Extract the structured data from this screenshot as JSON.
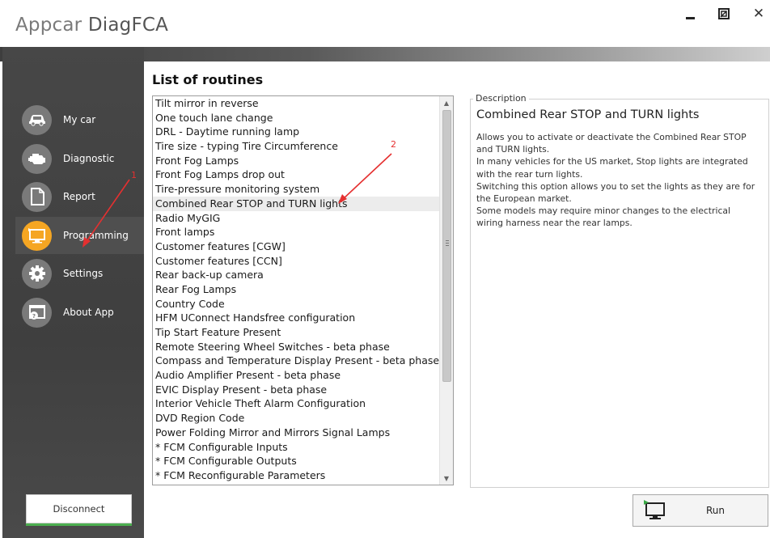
{
  "app": {
    "title_light": "Appcar ",
    "title_bold": "DiagFCA",
    "window_controls": {
      "minimize_icon": "minimize-icon",
      "maximize_icon": "maximize-icon",
      "close_glyph": "✕"
    }
  },
  "sidebar": {
    "items": [
      {
        "label": "My car",
        "icon": "car-icon",
        "active": false
      },
      {
        "label": "Diagnostic",
        "icon": "engine-icon",
        "active": false
      },
      {
        "label": "Report",
        "icon": "document-icon",
        "active": false
      },
      {
        "label": "Programming",
        "icon": "monitor-icon",
        "active": true
      },
      {
        "label": "Settings",
        "icon": "gear-icon",
        "active": false
      },
      {
        "label": "About App",
        "icon": "help-window-icon",
        "active": false
      }
    ],
    "disconnect_label": "Disconnect"
  },
  "main": {
    "title": "List of routines",
    "routines": [
      "Tilt mirror in reverse",
      "One touch lane change",
      "DRL - Daytime running lamp",
      "Tire size - typing Tire Circumference",
      "Front Fog Lamps",
      "Front Fog Lamps drop out",
      "Tire-pressure monitoring system",
      "Combined Rear STOP and TURN lights",
      "Radio MyGIG",
      "Front lamps",
      "Customer features [CGW]",
      "Customer features [CCN]",
      "Rear back-up camera",
      "Rear Fog Lamps",
      "Country Code",
      "HFM UConnect Handsfree configuration",
      "Tip Start Feature Present",
      "Remote Steering Wheel Switches - beta phase",
      "Compass and Temperature Display Present - beta phase",
      "Audio Amplifier Present - beta phase",
      "EVIC Display Present - beta phase",
      "Interior Vehicle Theft Alarm Configuration",
      "DVD Region Code",
      "Power Folding Mirror and Mirrors Signal Lamps",
      "* FCM Configurable Inputs",
      "* FCM Configurable Outputs",
      "* FCM Reconfigurable Parameters"
    ],
    "selected_index": 7,
    "description": {
      "legend": "Description",
      "title": "Combined Rear STOP and TURN lights",
      "lines": [
        "Allows you to activate or deactivate the Combined Rear STOP and TURN lights.",
        "In many vehicles for the US market, Stop lights are integrated with the rear turn lights.",
        "Switching this option allows you to set the lights as they are for the European market.",
        "Some models may require minor changes to the electrical wiring harness near the rear lamps."
      ]
    },
    "run_label": "Run"
  },
  "annotations": {
    "marker_1": "1",
    "marker_2": "2",
    "color": "#e53030"
  },
  "colors": {
    "accent": "#f5a623",
    "sidebar_bg": "#434343",
    "run_icon_green": "#3aa845"
  }
}
